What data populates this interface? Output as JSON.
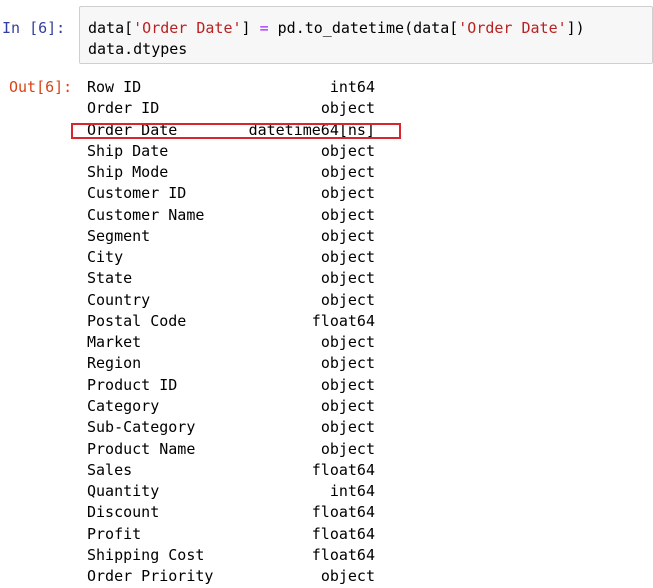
{
  "input_cell": {
    "prompt": "In  [6]:",
    "code_line_1": {
      "p1": "data[",
      "s1": "'Order Date'",
      "p2": "] ",
      "op": "=",
      "p3": " pd.to_datetime(data[",
      "s2": "'Order Date'",
      "p4": "])"
    },
    "code_line_2": "data.dtypes"
  },
  "output_cell": {
    "prompt": "Out[6]:",
    "rows": [
      {
        "name": "Row ID",
        "dtype": "int64"
      },
      {
        "name": "Order ID",
        "dtype": "object"
      },
      {
        "name": "Order Date",
        "dtype": "datetime64[ns]"
      },
      {
        "name": "Ship Date",
        "dtype": "object"
      },
      {
        "name": "Ship Mode",
        "dtype": "object"
      },
      {
        "name": "Customer ID",
        "dtype": "object"
      },
      {
        "name": "Customer Name",
        "dtype": "object"
      },
      {
        "name": "Segment",
        "dtype": "object"
      },
      {
        "name": "City",
        "dtype": "object"
      },
      {
        "name": "State",
        "dtype": "object"
      },
      {
        "name": "Country",
        "dtype": "object"
      },
      {
        "name": "Postal Code",
        "dtype": "float64"
      },
      {
        "name": "Market",
        "dtype": "object"
      },
      {
        "name": "Region",
        "dtype": "object"
      },
      {
        "name": "Product ID",
        "dtype": "object"
      },
      {
        "name": "Category",
        "dtype": "object"
      },
      {
        "name": "Sub-Category",
        "dtype": "object"
      },
      {
        "name": "Product Name",
        "dtype": "object"
      },
      {
        "name": "Sales",
        "dtype": "float64"
      },
      {
        "name": "Quantity",
        "dtype": "int64"
      },
      {
        "name": "Discount",
        "dtype": "float64"
      },
      {
        "name": "Profit",
        "dtype": "float64"
      },
      {
        "name": "Shipping Cost",
        "dtype": "float64"
      },
      {
        "name": "Order Priority",
        "dtype": "object"
      }
    ]
  },
  "colors": {
    "in_prompt": "#303f9f",
    "out_prompt": "#d84315",
    "string": "#ba2121",
    "operator": "#aa22ff",
    "highlight": "#d9262c",
    "input_bg": "#f7f7f7"
  }
}
